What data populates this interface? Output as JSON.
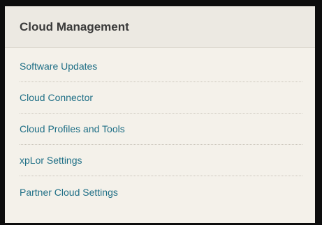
{
  "panel": {
    "title": "Cloud Management",
    "items": [
      {
        "label": "Software Updates"
      },
      {
        "label": "Cloud Connector"
      },
      {
        "label": "Cloud Profiles and Tools"
      },
      {
        "label": "xpLor Settings"
      },
      {
        "label": "Partner Cloud Settings"
      }
    ]
  },
  "colors": {
    "link": "#1f6f86",
    "title": "#3a3a3a",
    "background": "#f4f1ea",
    "frame": "#0d0d0d"
  }
}
